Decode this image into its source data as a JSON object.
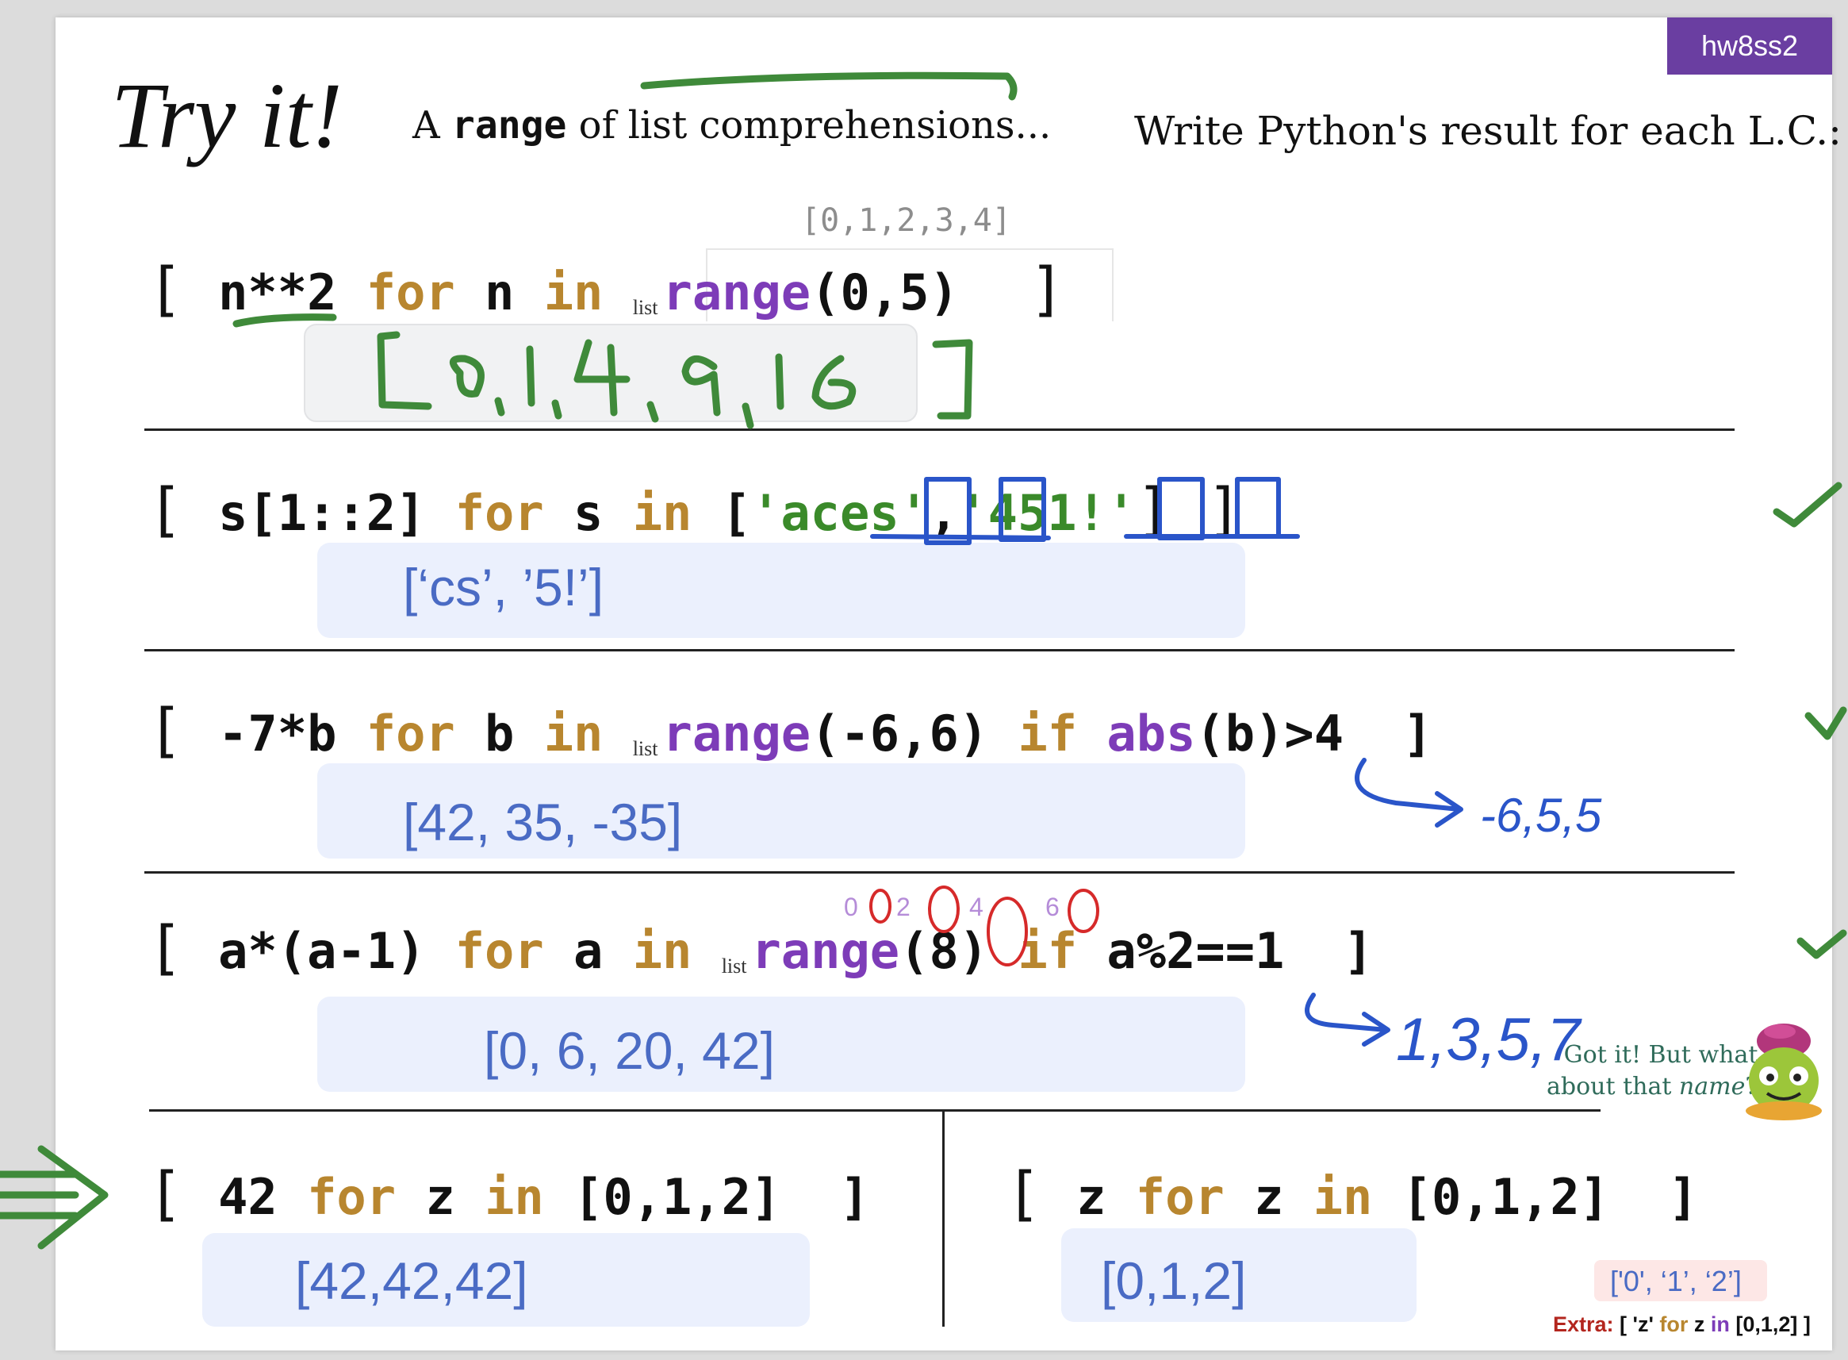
{
  "badge": "hw8ss2",
  "header": {
    "title": "Try it!",
    "subtitle_pre": "A ",
    "subtitle_kw": "range",
    "subtitle_post": " of list comprehensions...",
    "instructions": "Write Python's result for each L.C.:"
  },
  "hint": "[0,1,2,3,4]",
  "list_label": "list",
  "problems": [
    {
      "open": "[ ",
      "expr": "n**2 ",
      "kw1": "for",
      "var": " n ",
      "kw2": "in",
      "sp": " ",
      "fn": "range",
      "args": "(0,5)",
      "close": "  ]",
      "answer": "[0,1,4,9,16]"
    },
    {
      "open": "[ ",
      "expr": "s[1::2] ",
      "kw1": "for",
      "var": " s ",
      "kw2": "in",
      "sp": " [",
      "str1": "'aces'",
      "comma": ",",
      "str2": "'451!'",
      "close": "] ]",
      "answer": "[‘cs’, ’5!’]"
    },
    {
      "open": "[ ",
      "expr": "-7*b ",
      "kw1": "for",
      "var": " b ",
      "kw2": "in",
      "sp": " ",
      "fn": "range",
      "args": "(-6,6) ",
      "kw3": "if",
      "sp2": " ",
      "fn2": "abs",
      "args2": "(b)>4  ]",
      "answer": "[42, 35, -35]"
    },
    {
      "open": "[ ",
      "expr": "a*(a-1) ",
      "kw1": "for",
      "var": " a ",
      "kw2": "in",
      "sp": " ",
      "fn": "range",
      "args": "(8) ",
      "kw3": "if",
      "args2": " a%2==1  ]",
      "answer": "[0, 6, 20, 42]"
    },
    {
      "open": "[ ",
      "expr": "42 ",
      "kw1": "for",
      "var": " z ",
      "kw2": "in",
      "rest": " [0,1,2]  ]",
      "answer": "[42,42,42]"
    },
    {
      "open": "[ ",
      "expr": "z ",
      "kw1": "for",
      "var": " z ",
      "kw2": "in",
      "rest": " [0,1,2]  ]",
      "answer": "[0,1,2]"
    }
  ],
  "annotations": {
    "p3_note": "-6,5,5",
    "p4_note": "1,3,5,7"
  },
  "speech": {
    "line1": "Got it!  But what",
    "line2_pre": "about that ",
    "line2_em": "name",
    "line2_post": "?"
  },
  "extra": {
    "label": "Extra:",
    "pre": " [ 'z' ",
    "kw1": "for",
    "mid": " z ",
    "kw2": "in",
    "post": " [0,1,2] ]",
    "answer": "['0', ‘1’, ‘2’]"
  },
  "colors": {
    "badge": "#6a3ea1",
    "keyword": "#b8862f",
    "function": "#7d3cb8",
    "string": "#3a8a2a",
    "answer_text": "#4a6bc4",
    "answer_box": "#ebf0fd",
    "ink_green": "#3f8a3a",
    "ink_blue": "#2a55c9",
    "ink_red": "#d62a2a"
  }
}
